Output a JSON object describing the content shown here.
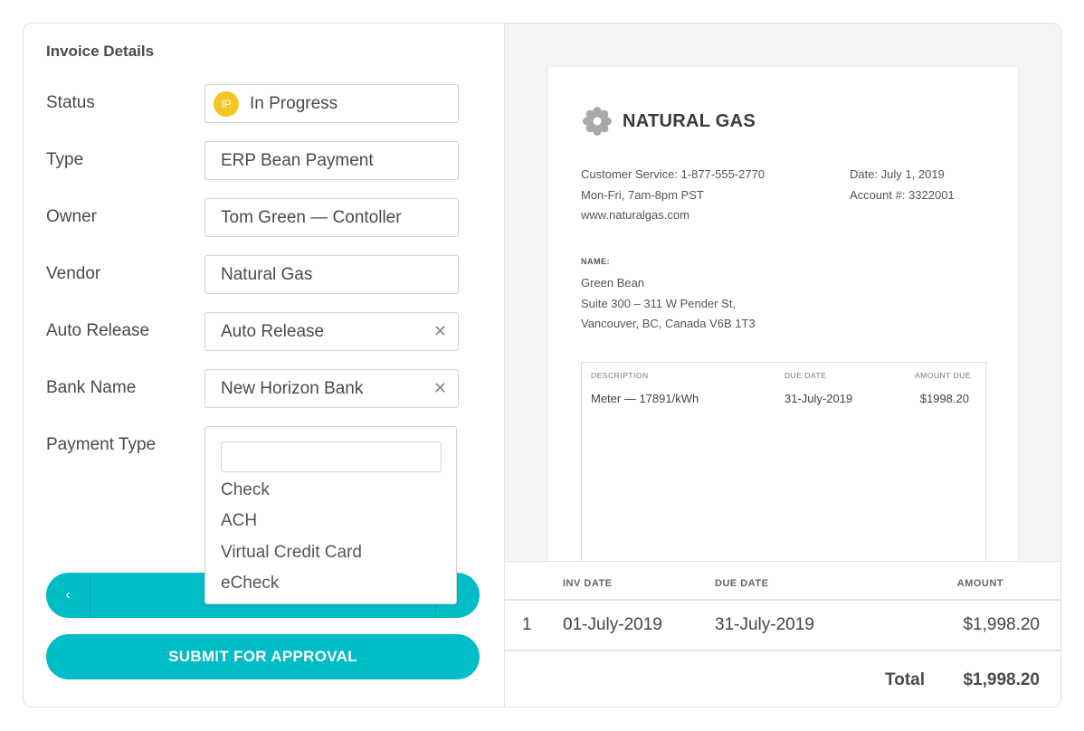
{
  "form": {
    "title": "Invoice Details",
    "fields": {
      "status": {
        "label": "Status",
        "value": "In Progress",
        "badge": "IP"
      },
      "type": {
        "label": "Type",
        "value": "ERP Bean Payment"
      },
      "owner": {
        "label": "Owner",
        "value": "Tom Green — Contoller"
      },
      "vendor": {
        "label": "Vendor",
        "value": "Natural Gas"
      },
      "auto_release": {
        "label": "Auto Release",
        "value": "Auto Release"
      },
      "bank_name": {
        "label": "Bank Name",
        "value": "New Horizon Bank"
      },
      "payment_type": {
        "label": "Payment Type",
        "search_value": ""
      }
    },
    "payment_options": [
      "Check",
      "ACH",
      "Virtual Credit Card",
      "eCheck"
    ],
    "pager_prev_glyph": "‹",
    "submit_label": "SUBMIT FOR APPROVAL"
  },
  "invoice": {
    "brand": "NATURAL GAS",
    "customer_service": "Customer Service: 1-877-555-2770",
    "hours": "Mon-Fri, 7am-8pm PST",
    "website": "www.naturalgas.com",
    "date": "Date: July 1, 2019",
    "account": "Account #: 3322001",
    "name_label": "NAME:",
    "name": "Green Bean",
    "address_line1": "Suite 300 – 311 W Pender St,",
    "address_line2": "Vancouver, BC, Canada V6B 1T3",
    "table": {
      "headers": {
        "description": "DESCRIPTION",
        "due_date": "DUE DATE",
        "amount_due": "AMOUNT DUE"
      },
      "row": {
        "description": "Meter — 17891/kWh",
        "due_date": "31-July-2019",
        "amount_due": "$1998.20"
      }
    }
  },
  "summary": {
    "headers": {
      "inv_date": "INV DATE",
      "due_date": "DUE  DATE",
      "amount": "AMOUNT"
    },
    "row": {
      "index": "1",
      "inv_date": "01-July-2019",
      "due_date": "31-July-2019",
      "amount": "$1,998.20"
    },
    "total_label": "Total",
    "total_value": "$1,998.20"
  },
  "colors": {
    "accent": "#00bcc6",
    "badge": "#f5c524"
  },
  "icons": {
    "brand": "flower-icon",
    "search": "search-icon",
    "clear": "close-icon",
    "prev": "chevron-left-icon"
  }
}
